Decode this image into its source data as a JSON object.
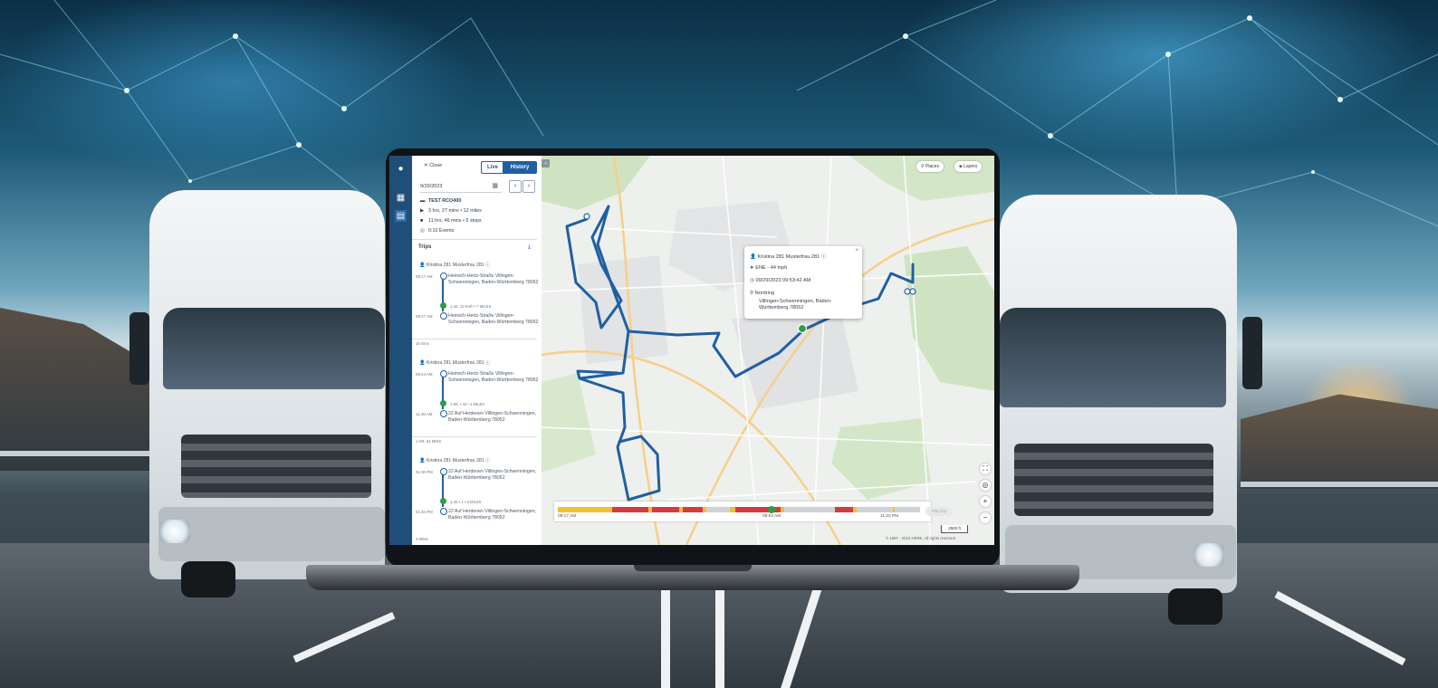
{
  "app": {
    "topbar": {
      "close_label": "✕ Close",
      "live_label": "Live",
      "history_label": "History"
    },
    "date": {
      "value": "9/29/2023"
    },
    "summary": {
      "vehicle": "TEST RCO400",
      "drive": "3 hrs, 27 mins • 12 miles",
      "stops": "11 hrs, 46 mins • 5 stops",
      "events": "0:10 Events"
    },
    "trips_header": "Trips",
    "trips": [
      {
        "driver": "Kristina 281 Musterfrau 281",
        "start_time": "08:17 AM",
        "start_addr": "Heinrich-Hertz-Straße Villingen-Schwenningen, Baden-Württemberg 78052",
        "stats": "1.4K, 11 km/h • 7 MILES",
        "end_time": "08:27 AM",
        "end_addr": "Heinrich-Hertz-Straße Villingen-Schwenningen, Baden-Württemberg 78052",
        "footer": "18 mins"
      },
      {
        "driver": "Kristina 281 Musterfrau 281",
        "start_time": "09:44 AM",
        "start_addr": "Heinrich-Hertz-Straße Villingen-Schwenningen, Baden-Württemberg 78052",
        "stats": "1.9K, • 44 • 4 MILES",
        "end_time": "11:46 AM",
        "end_addr": "22 Auf Herdenen Villingen-Schwenningen, Baden-Württemberg 78052",
        "footer": "1 HR, 54 MINS"
      },
      {
        "driver": "Kristina 281 Musterfrau 281",
        "start_time": "01:30 PM",
        "start_addr": "22 Auf Herdenen Villingen-Schwenningen, Baden-Württemberg 78052",
        "stats": "1.4K • 1 • 3 MILES",
        "end_time": "01:40 PM",
        "end_addr": "22 Auf Herdenen Villingen-Schwenningen, Baden-Württemberg 78052",
        "footer": "3 MINS"
      }
    ],
    "map": {
      "places_label": "Places",
      "layers_label": "Layers",
      "popup": {
        "driver": "Kristina 281 Musterfrau 281",
        "heading": "ENE - 44 mph",
        "timestamp": "09/29/2023 09:53:42 AM",
        "location_name": "Nordring",
        "location_addr": "Villingen-Schwenningen, Baden-Württemberg 78052"
      },
      "timeline": {
        "start": "08:17 AM",
        "mid": "09:53 AM",
        "end": "11:32 PM",
        "button": "Play trip"
      },
      "scale": "2500 ft",
      "copyright": "© 1987 - 2023 HERE. All rights reserved"
    }
  },
  "colors": {
    "brand": "#1f5fa3",
    "rail": "#1f4e79",
    "route": "#1f5fa3",
    "stop": "#2e9d45"
  }
}
